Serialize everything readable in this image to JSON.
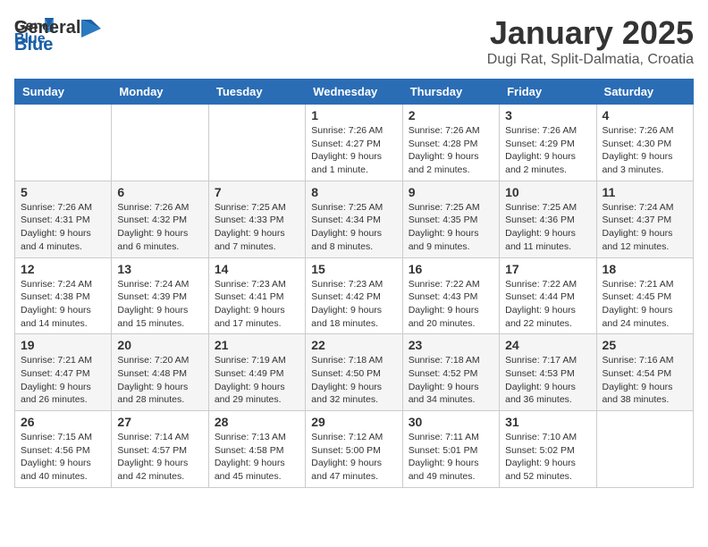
{
  "header": {
    "logo_general": "General",
    "logo_blue": "Blue",
    "month_title": "January 2025",
    "location": "Dugi Rat, Split-Dalmatia, Croatia"
  },
  "days_of_week": [
    "Sunday",
    "Monday",
    "Tuesday",
    "Wednesday",
    "Thursday",
    "Friday",
    "Saturday"
  ],
  "weeks": [
    [
      {
        "day": "",
        "info": ""
      },
      {
        "day": "",
        "info": ""
      },
      {
        "day": "",
        "info": ""
      },
      {
        "day": "1",
        "info": "Sunrise: 7:26 AM\nSunset: 4:27 PM\nDaylight: 9 hours\nand 1 minute."
      },
      {
        "day": "2",
        "info": "Sunrise: 7:26 AM\nSunset: 4:28 PM\nDaylight: 9 hours\nand 2 minutes."
      },
      {
        "day": "3",
        "info": "Sunrise: 7:26 AM\nSunset: 4:29 PM\nDaylight: 9 hours\nand 2 minutes."
      },
      {
        "day": "4",
        "info": "Sunrise: 7:26 AM\nSunset: 4:30 PM\nDaylight: 9 hours\nand 3 minutes."
      }
    ],
    [
      {
        "day": "5",
        "info": "Sunrise: 7:26 AM\nSunset: 4:31 PM\nDaylight: 9 hours\nand 4 minutes."
      },
      {
        "day": "6",
        "info": "Sunrise: 7:26 AM\nSunset: 4:32 PM\nDaylight: 9 hours\nand 6 minutes."
      },
      {
        "day": "7",
        "info": "Sunrise: 7:25 AM\nSunset: 4:33 PM\nDaylight: 9 hours\nand 7 minutes."
      },
      {
        "day": "8",
        "info": "Sunrise: 7:25 AM\nSunset: 4:34 PM\nDaylight: 9 hours\nand 8 minutes."
      },
      {
        "day": "9",
        "info": "Sunrise: 7:25 AM\nSunset: 4:35 PM\nDaylight: 9 hours\nand 9 minutes."
      },
      {
        "day": "10",
        "info": "Sunrise: 7:25 AM\nSunset: 4:36 PM\nDaylight: 9 hours\nand 11 minutes."
      },
      {
        "day": "11",
        "info": "Sunrise: 7:24 AM\nSunset: 4:37 PM\nDaylight: 9 hours\nand 12 minutes."
      }
    ],
    [
      {
        "day": "12",
        "info": "Sunrise: 7:24 AM\nSunset: 4:38 PM\nDaylight: 9 hours\nand 14 minutes."
      },
      {
        "day": "13",
        "info": "Sunrise: 7:24 AM\nSunset: 4:39 PM\nDaylight: 9 hours\nand 15 minutes."
      },
      {
        "day": "14",
        "info": "Sunrise: 7:23 AM\nSunset: 4:41 PM\nDaylight: 9 hours\nand 17 minutes."
      },
      {
        "day": "15",
        "info": "Sunrise: 7:23 AM\nSunset: 4:42 PM\nDaylight: 9 hours\nand 18 minutes."
      },
      {
        "day": "16",
        "info": "Sunrise: 7:22 AM\nSunset: 4:43 PM\nDaylight: 9 hours\nand 20 minutes."
      },
      {
        "day": "17",
        "info": "Sunrise: 7:22 AM\nSunset: 4:44 PM\nDaylight: 9 hours\nand 22 minutes."
      },
      {
        "day": "18",
        "info": "Sunrise: 7:21 AM\nSunset: 4:45 PM\nDaylight: 9 hours\nand 24 minutes."
      }
    ],
    [
      {
        "day": "19",
        "info": "Sunrise: 7:21 AM\nSunset: 4:47 PM\nDaylight: 9 hours\nand 26 minutes."
      },
      {
        "day": "20",
        "info": "Sunrise: 7:20 AM\nSunset: 4:48 PM\nDaylight: 9 hours\nand 28 minutes."
      },
      {
        "day": "21",
        "info": "Sunrise: 7:19 AM\nSunset: 4:49 PM\nDaylight: 9 hours\nand 29 minutes."
      },
      {
        "day": "22",
        "info": "Sunrise: 7:18 AM\nSunset: 4:50 PM\nDaylight: 9 hours\nand 32 minutes."
      },
      {
        "day": "23",
        "info": "Sunrise: 7:18 AM\nSunset: 4:52 PM\nDaylight: 9 hours\nand 34 minutes."
      },
      {
        "day": "24",
        "info": "Sunrise: 7:17 AM\nSunset: 4:53 PM\nDaylight: 9 hours\nand 36 minutes."
      },
      {
        "day": "25",
        "info": "Sunrise: 7:16 AM\nSunset: 4:54 PM\nDaylight: 9 hours\nand 38 minutes."
      }
    ],
    [
      {
        "day": "26",
        "info": "Sunrise: 7:15 AM\nSunset: 4:56 PM\nDaylight: 9 hours\nand 40 minutes."
      },
      {
        "day": "27",
        "info": "Sunrise: 7:14 AM\nSunset: 4:57 PM\nDaylight: 9 hours\nand 42 minutes."
      },
      {
        "day": "28",
        "info": "Sunrise: 7:13 AM\nSunset: 4:58 PM\nDaylight: 9 hours\nand 45 minutes."
      },
      {
        "day": "29",
        "info": "Sunrise: 7:12 AM\nSunset: 5:00 PM\nDaylight: 9 hours\nand 47 minutes."
      },
      {
        "day": "30",
        "info": "Sunrise: 7:11 AM\nSunset: 5:01 PM\nDaylight: 9 hours\nand 49 minutes."
      },
      {
        "day": "31",
        "info": "Sunrise: 7:10 AM\nSunset: 5:02 PM\nDaylight: 9 hours\nand 52 minutes."
      },
      {
        "day": "",
        "info": ""
      }
    ]
  ]
}
